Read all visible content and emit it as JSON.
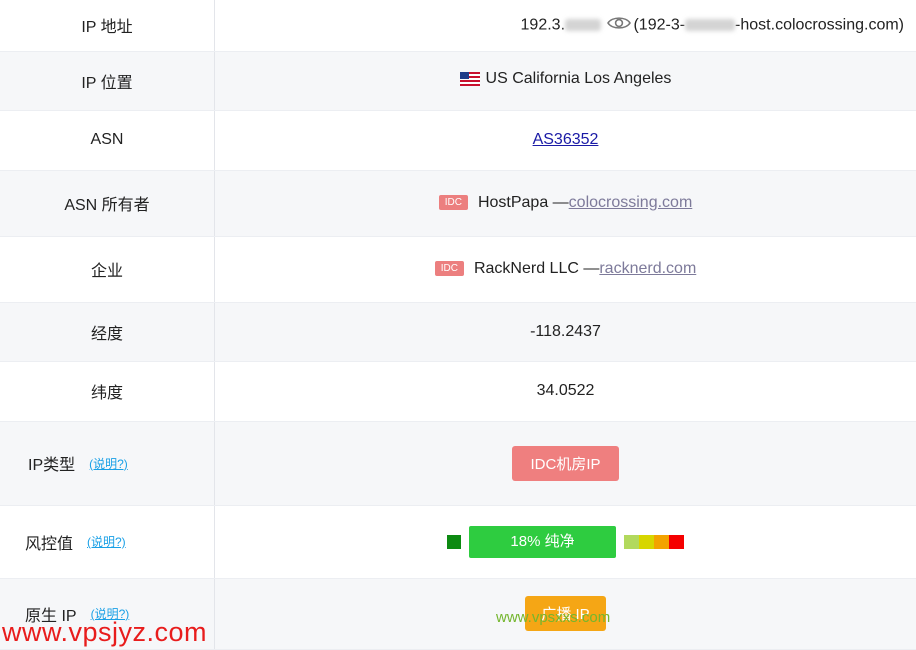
{
  "rows": {
    "ip_address": {
      "label": "IP 地址",
      "ip_prefix": "192.3.",
      "host_prefix": "(192-3-",
      "host_suffix": "-host.colocrossing.com)"
    },
    "ip_location": {
      "label": "IP 位置",
      "flag": "🇺🇸",
      "value": "US California Los Angeles"
    },
    "asn": {
      "label": "ASN",
      "value": "AS36352"
    },
    "asn_owner": {
      "label": "ASN 所有者",
      "tag": "IDC",
      "name": "HostPapa —",
      "domain": "colocrossing.com"
    },
    "company": {
      "label": "企业",
      "tag": "IDC",
      "name": "RackNerd LLC —",
      "domain": "racknerd.com"
    },
    "longitude": {
      "label": "经度",
      "value": "-118.2437"
    },
    "latitude": {
      "label": "纬度",
      "value": "34.0522"
    },
    "ip_type": {
      "label": "IP类型",
      "help": "(说明?)",
      "value": "IDC机房IP"
    },
    "risk": {
      "label": "风控值",
      "help": "(说明?)",
      "value": "18%  纯净"
    },
    "native_ip": {
      "label": "原生 IP",
      "help": "(说明?)",
      "value": "广播 IP"
    }
  },
  "watermarks": {
    "site1": "www.vpsxxs.com",
    "site2": "www.vpsjyz.com"
  },
  "colors": {
    "idc_tag": "#ec7f7f",
    "ip_type_badge": "#ef7f7f",
    "risk_bar": "#2ecc40",
    "native_badge": "#f5a615",
    "link": "#1a1aa6",
    "help_link": "#1aa0e6"
  }
}
